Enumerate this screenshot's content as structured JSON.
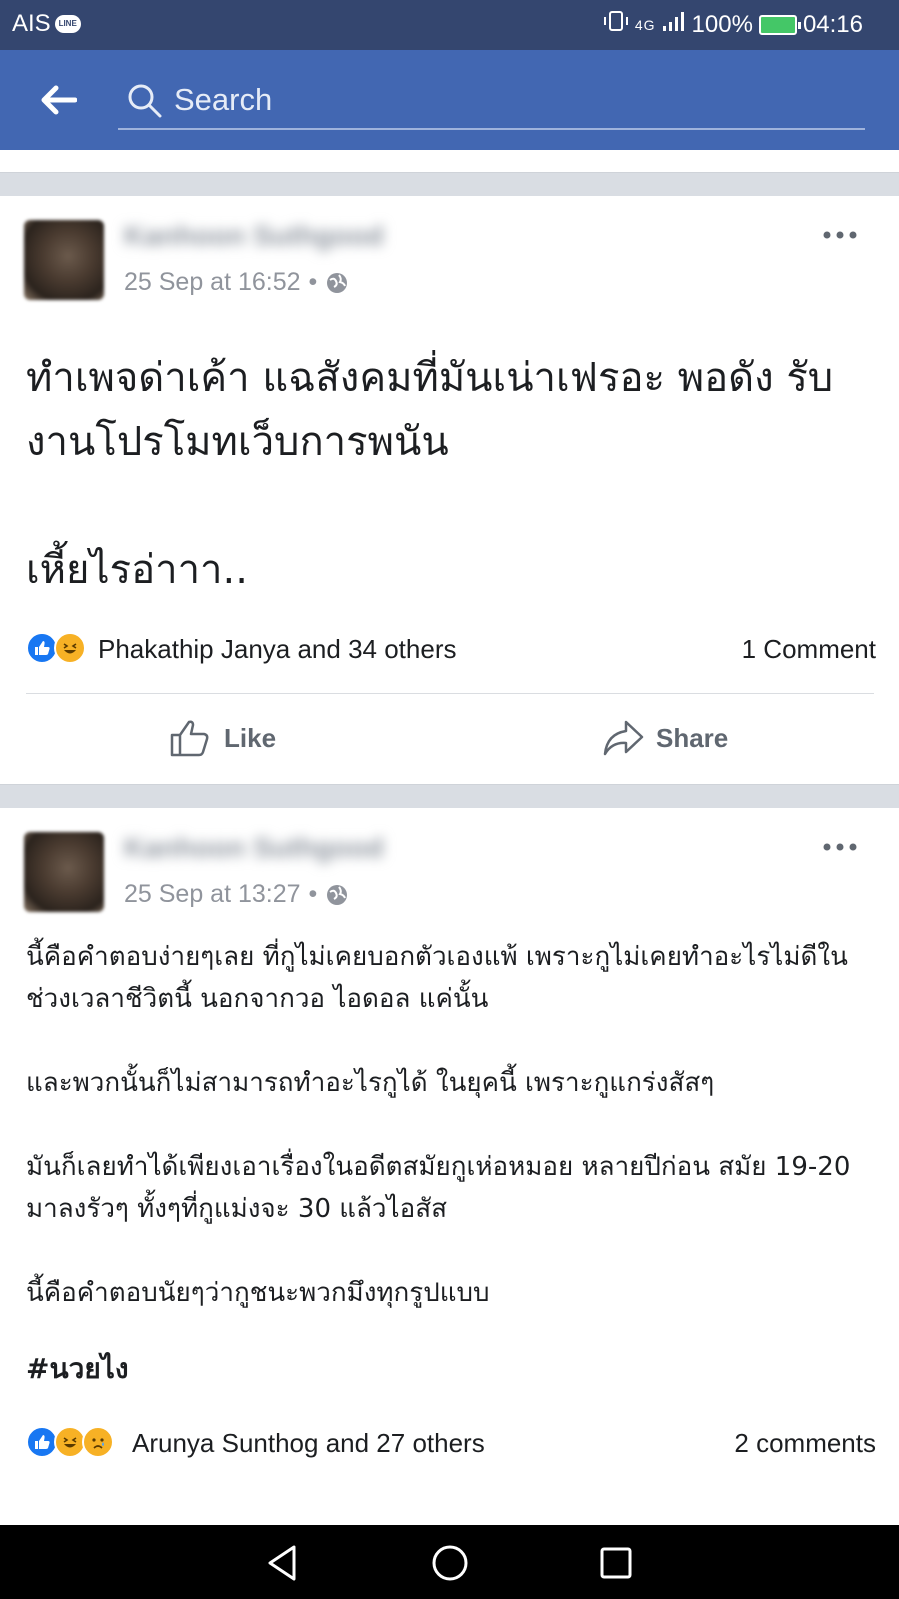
{
  "status_bar": {
    "carrier": "AIS",
    "line_badge": "LINE",
    "network": "4G",
    "battery": "100%",
    "time": "04:16"
  },
  "navbar": {
    "search_placeholder": "Search"
  },
  "posts": [
    {
      "author": "Kanhoon Suthgood",
      "date": "25 Sep at 16:52",
      "separator": "•",
      "text": "ทำเพจด่าเค้า แฉสังคมที่มันเน่าเฟรอะ พอดัง รับงานโปรโมทเว็บการพนัน\n\nเหี้ยไรอ่าาา..",
      "reaction_names": "Phakathip Janya and 34 others",
      "comment_count": "1 Comment",
      "like_label": "Like",
      "share_label": "Share"
    },
    {
      "author": "Kanhoon Suthgood",
      "date": "25 Sep at 13:27",
      "separator": "•",
      "text": "นี้คือคำตอบง่ายๆเลย ที่กูไม่เคยบอกตัวเองแพ้ เพราะกูไม่เคยทำอะไรไม่ดีในช่วงเวลาชีวิตนี้ นอกจากวอ ไอดอล แค่นั้น\n\nและพวกนั้นก็ไม่สามารถทำอะไรกูได้ ในยุคนี้ เพราะกูแกร่งสัสๆ\n\nมันก็เลยทำได้เพียงเอาเรื่องในอดีตสมัยกูเห่อหมอย หลายปีก่อน สมัย 19-20 มาลงรัวๆ ทั้งๆที่กูแม่งจะ 30 แล้วไอสัส\n\nนี้คือคำตอบนัยๆว่ากูชนะพวกมึงทุกรูปแบบ",
      "hashtag": "#นวยไง",
      "reaction_names": "Arunya Sunthog and 27 others",
      "comment_count": "2 comments"
    }
  ],
  "colors": {
    "status_bar": "#34466f",
    "navbar": "#4267b2",
    "like_blue": "#1877f2",
    "haha_yellow": "#f7b125"
  }
}
